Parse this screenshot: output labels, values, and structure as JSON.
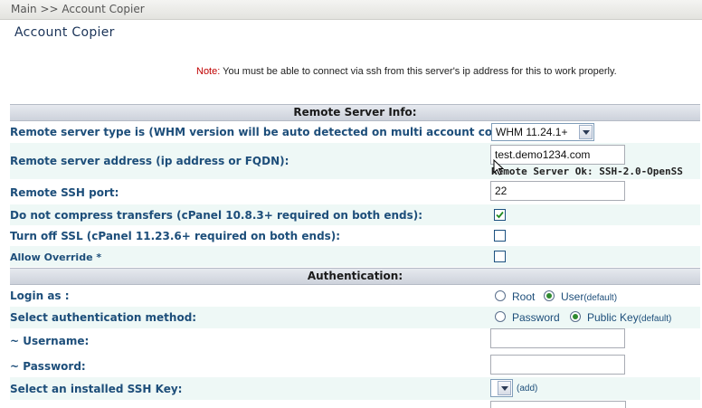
{
  "breadcrumb": "Main >> Account Copier",
  "page_title": "Account Copier",
  "note": {
    "label": "Note:",
    "text": "You must be able to connect via ssh from this server's ip address for this to work properly."
  },
  "sections": {
    "remote": {
      "title": "Remote Server Info:",
      "server_type": {
        "label": "Remote server type is (WHM version will be auto detected on multi account copies):",
        "value": "WHM 11.24.1+"
      },
      "address": {
        "label": "Remote server address (ip address or FQDN):",
        "value": "test.demo1234.com",
        "status": "Remote Server Ok: SSH-2.0-OpenSS"
      },
      "ssh_port": {
        "label": "Remote SSH port:",
        "value": "22"
      },
      "no_compress": {
        "label": "Do not compress transfers (cPanel 10.8.3+ required on both ends):",
        "checked": true
      },
      "ssl_off": {
        "label": "Turn off SSL (cPanel 11.23.6+ required on both ends):",
        "checked": false
      },
      "allow_override": {
        "label": "Allow Override *",
        "checked": false
      }
    },
    "auth": {
      "title": "Authentication:",
      "login_as": {
        "label": "Login as :",
        "opt1": "Root",
        "opt2": "User",
        "opt2_note": "(default)",
        "selected": "User"
      },
      "method": {
        "label": "Select authentication method:",
        "opt1": "Password",
        "opt2": "Public Key",
        "opt2_note": "(default)",
        "selected": "Public Key"
      },
      "username": {
        "label": "~ Username:",
        "value": ""
      },
      "password": {
        "label": "~ Password:",
        "value": ""
      },
      "ssh_key": {
        "label": "Select an installed SSH Key:",
        "add_link": "(add)"
      }
    }
  },
  "colors": {
    "note_label": "#c00000",
    "label_text": "#1d4e7a",
    "alt_row": "#eef8f6",
    "radio_on": "#2f8a2f"
  }
}
